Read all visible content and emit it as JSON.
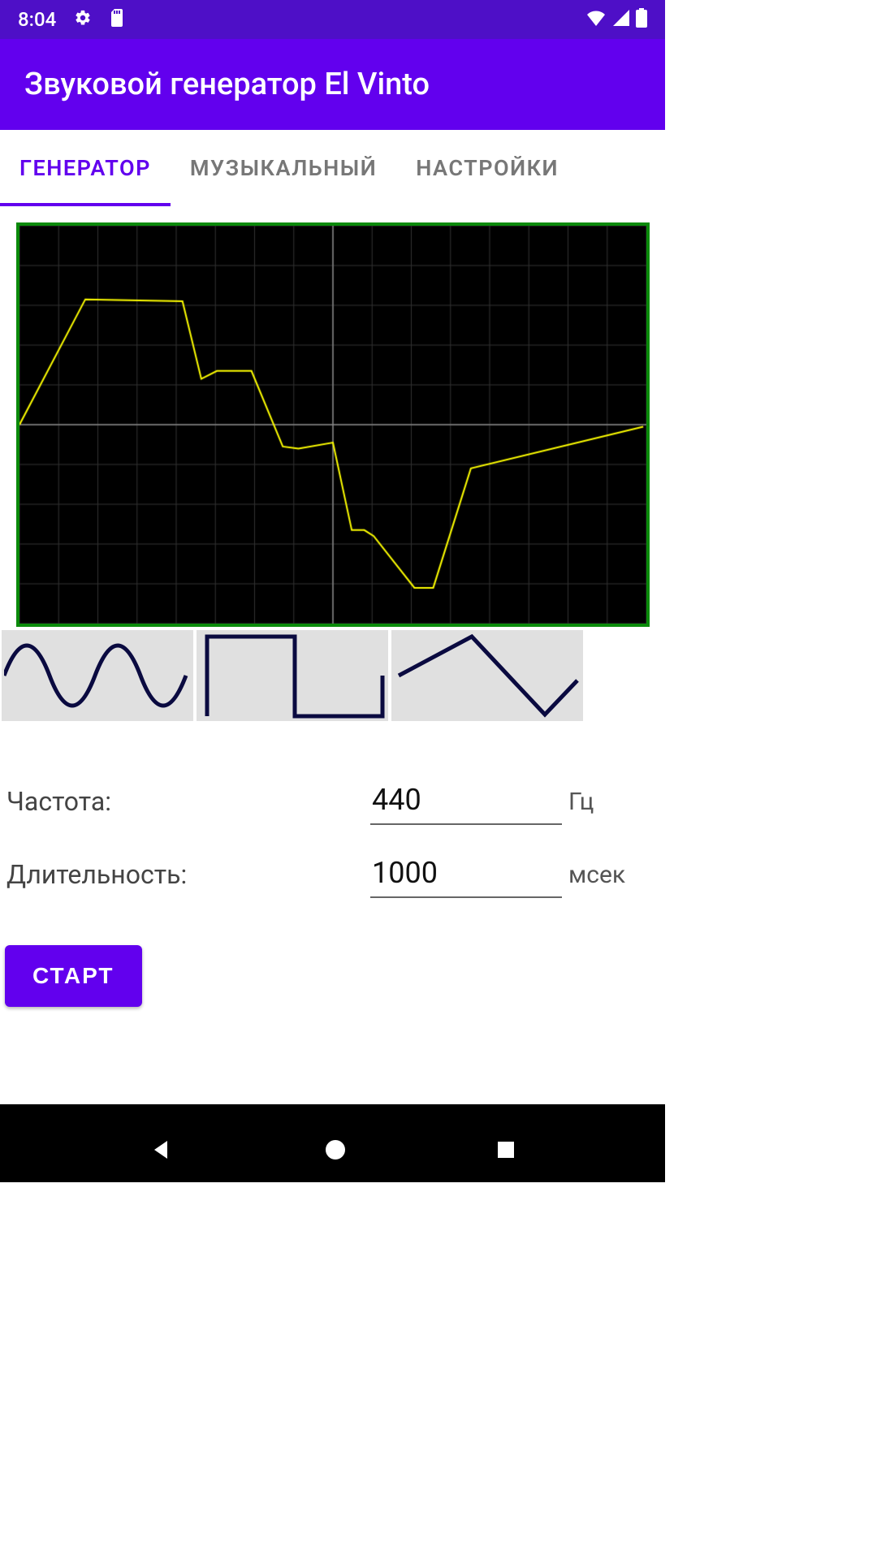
{
  "status": {
    "time": "8:04"
  },
  "app": {
    "title": "Звуковой генератор El Vinto"
  },
  "tabs": [
    {
      "label": "ГЕНЕРАТОР",
      "active": true
    },
    {
      "label": "МУЗЫКАЛЬНЫЙ",
      "active": false
    },
    {
      "label": "НАСТРОЙКИ",
      "active": false
    }
  ],
  "waveform_buttons": [
    "sine",
    "square",
    "triangle"
  ],
  "form": {
    "frequency": {
      "label": "Частота:",
      "value": "440",
      "unit": "Гц"
    },
    "duration": {
      "label": "Длительность:",
      "value": "1000",
      "unit": "мсек"
    }
  },
  "start_button": "СТАРТ",
  "chart_data": {
    "type": "line",
    "title": "",
    "xlabel": "",
    "ylabel": "",
    "xlim": [
      -1,
      1
    ],
    "ylim": [
      -1,
      1
    ],
    "x": [
      -1.0,
      -0.79,
      -0.48,
      -0.42,
      -0.37,
      -0.26,
      -0.16,
      -0.11,
      0.0,
      0.06,
      0.1,
      0.13,
      0.26,
      0.32,
      0.44,
      0.99
    ],
    "values": [
      0.0,
      0.63,
      0.62,
      0.23,
      0.27,
      0.27,
      -0.11,
      -0.12,
      -0.09,
      -0.53,
      -0.53,
      -0.56,
      -0.82,
      -0.82,
      -0.22,
      -0.01
    ],
    "style": {
      "line_color": "#ffff00",
      "bg": "#000",
      "grid": "#333",
      "axes": "#888"
    }
  }
}
